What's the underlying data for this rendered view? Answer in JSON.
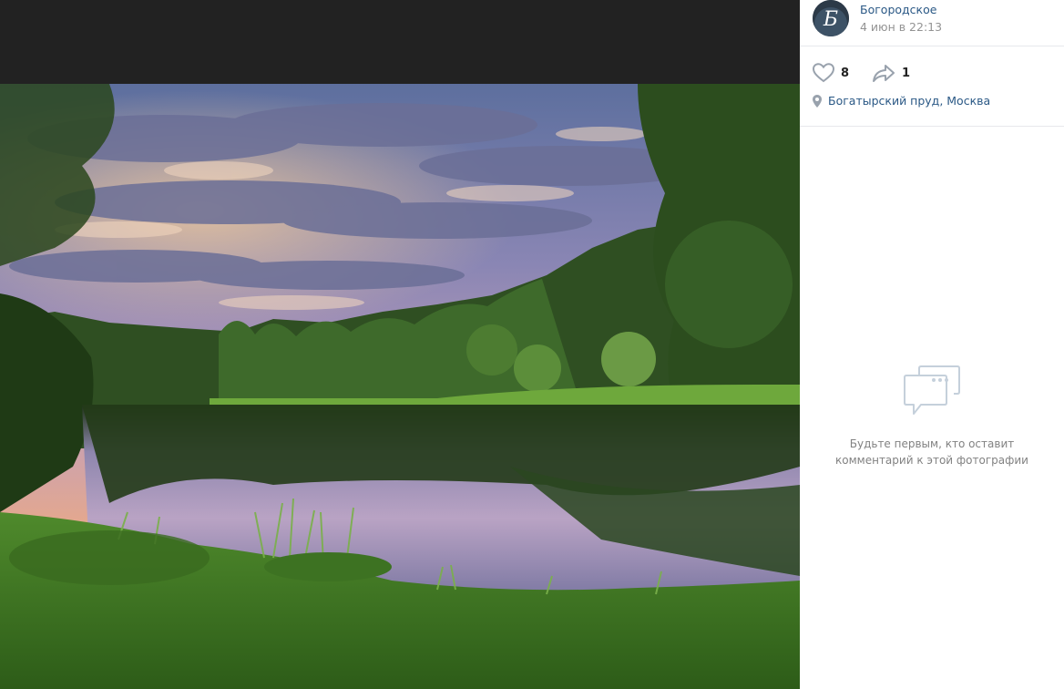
{
  "post": {
    "author": "Богородское",
    "date": "4 июн в 22:13",
    "avatar_letter": "Б"
  },
  "actions": {
    "likes": "8",
    "shares": "1"
  },
  "location": "Богатырский пруд, Москва",
  "comments": {
    "empty_text": "Будьте первым, кто оставит комментарий к этой фотографии"
  },
  "colors": {
    "link": "#2a5885",
    "muted": "#939393",
    "icon": "#99a2ad",
    "top_bar": "#222222"
  },
  "icons": [
    "like-heart-icon",
    "share-arrow-icon",
    "location-pin-icon",
    "comments-bubble-icon"
  ]
}
